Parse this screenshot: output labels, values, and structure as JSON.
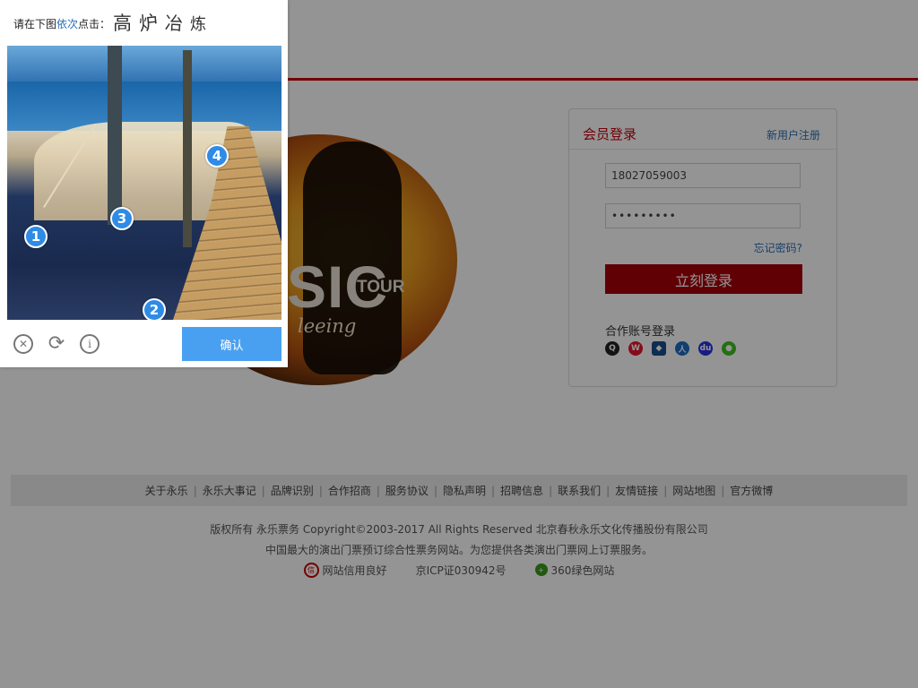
{
  "login": {
    "title": "会员登录",
    "register_label": "新用户注册",
    "phone_value": "18027059003",
    "password_value": "•••••••••",
    "forgot_label": "忘记密码?",
    "submit_label": "立刻登录",
    "partner_label": "合作账号登录",
    "partner_icons": [
      "qq-icon",
      "weibo-icon",
      "shield-icon",
      "renren-icon",
      "baidu-icon",
      "wechat-icon"
    ]
  },
  "hero": {
    "title_fragment": "SIC",
    "tour_label": "TOUR",
    "script_fragment": "leeing"
  },
  "footer": {
    "links": [
      "关于永乐",
      "永乐大事记",
      "品牌识别",
      "合作招商",
      "服务协议",
      "隐私声明",
      "招聘信息",
      "联系我们",
      "友情链接",
      "网站地图",
      "官方微博"
    ],
    "copyright": "版权所有 永乐票务 Copyright©2003-2017 All Rights Reserved 北京春秋永乐文化传播股份有限公司",
    "description": "中国最大的演出门票预订综合性票务网站。为您提供各类演出门票网上订票服务。",
    "badges": [
      "网站信用良好",
      "京ICP证030942号",
      "360绿色网站"
    ]
  },
  "captcha": {
    "prompt_prefix": "请在下图",
    "prompt_highlight": "依次",
    "prompt_suffix": "点击：",
    "target_chars": [
      "高",
      "炉",
      "冶",
      "炼"
    ],
    "markers": [
      "1",
      "2",
      "3",
      "4"
    ],
    "confirm_label": "确认",
    "colors": {
      "accent": "#4aa0f0",
      "marker": "#2f8be6",
      "highlight": "#2a6fb4"
    }
  },
  "colors": {
    "brand_red": "#c7000b",
    "login_button": "#a6000a"
  }
}
